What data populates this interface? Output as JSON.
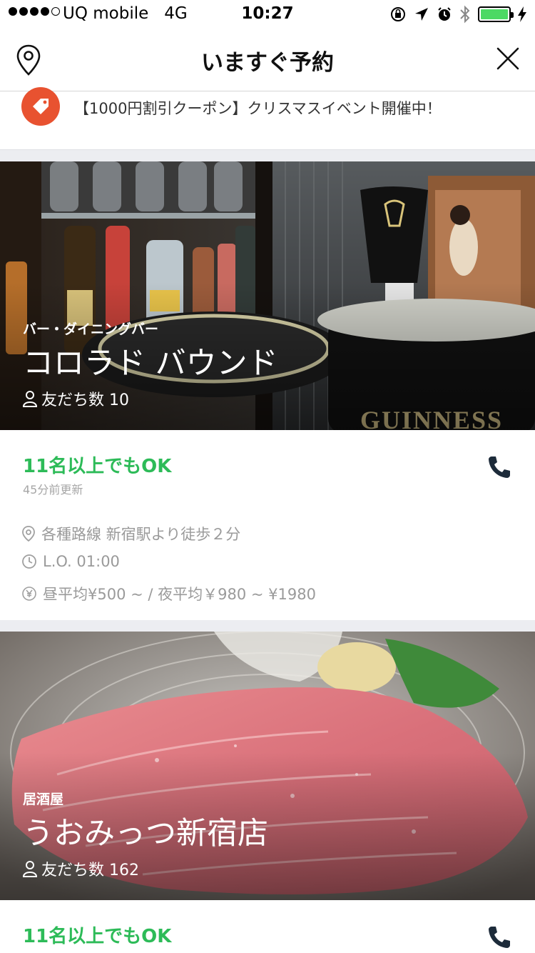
{
  "status_bar": {
    "carrier": "UQ mobile",
    "network": "4G",
    "time": "10:27"
  },
  "header": {
    "title": "いますぐ予約"
  },
  "coupon": {
    "text": "【1000円割引クーポン】クリスマスイベント開催中！"
  },
  "restaurants": [
    {
      "category": "バー・ダイニングバー",
      "name": "コロラド バウンド",
      "friends": "友だち数 10",
      "availability": "11名以上でもOK",
      "updated": "45分前更新",
      "access": "各種路線 新宿駅より徒歩２分",
      "last_order": "L.O. 01:00",
      "price": "昼平均¥500 ~ / 夜平均￥980 ~ ¥1980"
    },
    {
      "category": "居酒屋",
      "name": "うおみっつ新宿店",
      "friends": "友だち数 162",
      "availability": "11名以上でもOK"
    }
  ],
  "colors": {
    "accent_green": "#2dbb58",
    "coupon_orange": "#e85230",
    "muted": "#9a9a9a"
  },
  "icons": [
    "map-pin-icon",
    "close-icon",
    "tag-icon",
    "person-icon",
    "phone-icon",
    "location-icon",
    "clock-icon",
    "yen-icon"
  ]
}
